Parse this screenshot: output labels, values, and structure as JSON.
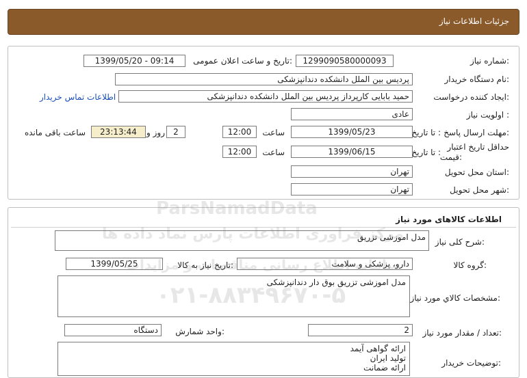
{
  "header": {
    "title": "جزئیات اطلاعات نیاز"
  },
  "info": {
    "need_number_label": "شماره نیاز:",
    "need_number": "1299090580000093",
    "announce_label": "تاریخ و ساعت اعلان عمومی:",
    "announce_value": "1399/05/20 - 09:14",
    "buyer_org_label": "نام دستگاه خریدار:",
    "buyer_org": "پردیس بین الملل دانشکده دندانپزشکی",
    "creator_label": "ایجاد کننده درخواست:",
    "creator": "حمید بابایی کارپرداز پردیس بین الملل دانشکده دندانپزشکی",
    "contact_link": "اطلاعات تماس خریدار",
    "priority_label": "اولویت نیاز :",
    "priority": "عادی",
    "deadline_label": "مهلت ارسال پاسخ:",
    "until_date_label": "تا تاریخ :",
    "deadline_date": "1399/05/23",
    "time_label": "ساعت",
    "deadline_time": "12:00",
    "days_value": "2",
    "days_label": "روز و",
    "remaining_time": "23:13:44",
    "remaining_label": "ساعت باقی مانده",
    "price_validity_label_1": "حداقل تاریخ اعتبار",
    "price_validity_label_2": "قیمت:",
    "validity_until_label": "تا تاریخ :",
    "validity_date": "1399/06/15",
    "validity_time_label": "ساعت",
    "validity_time": "12:00",
    "province_label": "استان محل تحویل:",
    "province": "تهران",
    "city_label": "شهر محل تحویل:",
    "city": "تهران"
  },
  "goods": {
    "section_title": "اطلاعات کالاهای مورد نیاز",
    "summary_label": "شرح کلی نیاز:",
    "summary": "مدل اموزشی تزریق",
    "group_label": "گروه کالا:",
    "group": "دارو، پزشکی و سلامت",
    "need_date_label": "تاریخ نیاز به کالا:",
    "need_date": "1399/05/25",
    "specs_label": "مشخصات کالاي مورد نياز:",
    "specs": "مدل اموزشی تزریق بوق دار دندانپزشکی",
    "qty_label": "تعداد / مقدار مورد نیاز:",
    "qty": "2",
    "unit_label": "واحد شمارش:",
    "unit": "دستگاه",
    "notes_label": "توضیحات خریدار:",
    "notes": [
      "ارائه گواهی آیمد",
      "تولید ایران",
      "ارائه ضمانت"
    ]
  },
  "watermark": {
    "brand": "ParsNamadData",
    "line1": "مرکز فراوری اطلاعات پارس نماد داده ها",
    "line2": "سامانه اطلاع رسانی مناقصات و مزایدات",
    "phone": "۰۲۱-۸۸۳۴۹۶۷۰-۵"
  }
}
